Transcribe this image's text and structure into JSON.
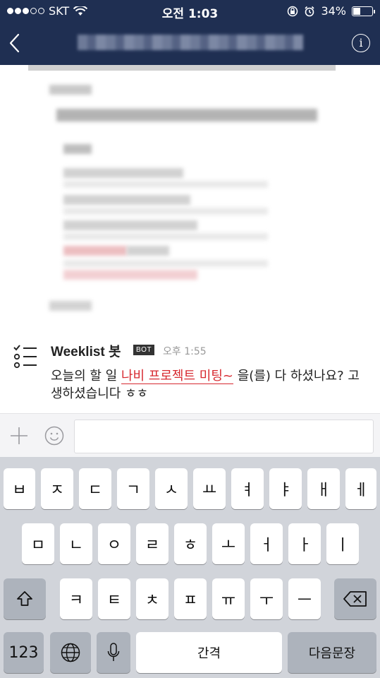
{
  "status_bar": {
    "carrier": "SKT",
    "time": "오전 1:03",
    "battery": "34%",
    "battery_level": 0.34,
    "icons": [
      "signal-dots",
      "wifi-icon",
      "rotation-lock-icon",
      "alarm-icon",
      "battery-icon"
    ]
  },
  "header": {
    "back_icon": "chevron-left-icon",
    "info_icon": "info-icon",
    "info_label": "i"
  },
  "message": {
    "sender": "Weeklist 봇",
    "badge": "BOT",
    "time": "오후 1:55",
    "text_before": "오늘의 할 일 ",
    "highlight": "나비 프로젝트 미팅~",
    "text_after": " 을(를) 다 하셨나요? 고생하셨습니다 ㅎㅎ",
    "icon": "checklist-icon",
    "highlight_color": "#d7282f"
  },
  "composer": {
    "plus_icon": "plus-icon",
    "emoji_icon": "smiley-icon",
    "placeholder": ""
  },
  "keyboard": {
    "row1": [
      "ㅂ",
      "ㅈ",
      "ㄷ",
      "ㄱ",
      "ㅅ",
      "ㅛ",
      "ㅕ",
      "ㅑ",
      "ㅐ",
      "ㅔ"
    ],
    "row2": [
      "ㅁ",
      "ㄴ",
      "ㅇ",
      "ㄹ",
      "ㅎ",
      "ㅗ",
      "ㅓ",
      "ㅏ",
      "ㅣ"
    ],
    "row3": [
      "ㅋ",
      "ㅌ",
      "ㅊ",
      "ㅍ",
      "ㅠ",
      "ㅜ",
      "ㅡ"
    ],
    "numbers_label": "123",
    "space_label": "간격",
    "return_label": "다음문장",
    "shift_icon": "shift-icon",
    "delete_icon": "delete-icon",
    "globe_icon": "globe-icon",
    "mic_icon": "microphone-icon"
  },
  "colors": {
    "header_bg": "#1f2f52",
    "keyboard_bg": "#d1d4da"
  }
}
